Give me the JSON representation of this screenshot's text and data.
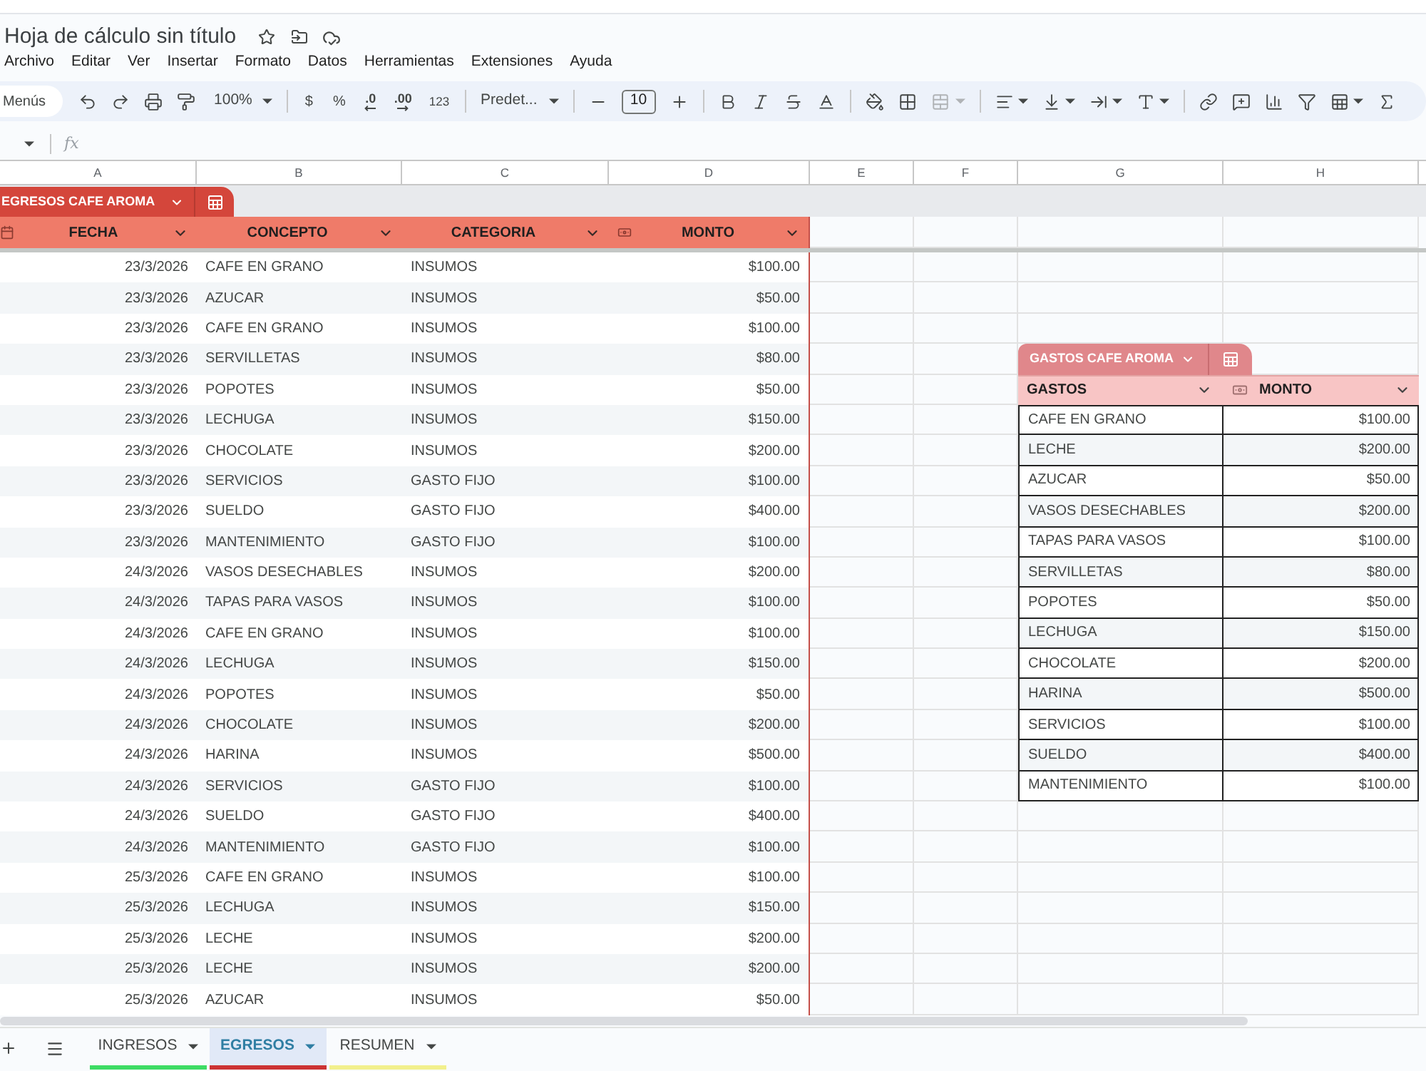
{
  "document": {
    "title": "Hoja de cálculo sin título"
  },
  "menu_bar": [
    "Archivo",
    "Editar",
    "Ver",
    "Insertar",
    "Formato",
    "Datos",
    "Herramientas",
    "Extensiones",
    "Ayuda"
  ],
  "toolbar": {
    "menu_search": "Menús",
    "zoom": "100%",
    "currency": "$",
    "percent": "%",
    "decrease_decimals": ".0",
    "increase_decimals": ".00",
    "number_format": "123",
    "font": "Predet...",
    "font_size": "10"
  },
  "formula_bar": {
    "label": "fx"
  },
  "column_headers": [
    "A",
    "B",
    "C",
    "D",
    "E",
    "F",
    "G",
    "H"
  ],
  "expenses_table": {
    "name": "EGRESOS CAFE AROMA",
    "columns": [
      "FECHA",
      "CONCEPTO",
      "CATEGORIA",
      "MONTO"
    ],
    "rows": [
      [
        "23/3/2026",
        "CAFE EN GRANO",
        "INSUMOS",
        "$100.00"
      ],
      [
        "23/3/2026",
        "AZUCAR",
        "INSUMOS",
        "$50.00"
      ],
      [
        "23/3/2026",
        "CAFE EN GRANO",
        "INSUMOS",
        "$100.00"
      ],
      [
        "23/3/2026",
        "SERVILLETAS",
        "INSUMOS",
        "$80.00"
      ],
      [
        "23/3/2026",
        "POPOTES",
        "INSUMOS",
        "$50.00"
      ],
      [
        "23/3/2026",
        "LECHUGA",
        "INSUMOS",
        "$150.00"
      ],
      [
        "23/3/2026",
        "CHOCOLATE",
        "INSUMOS",
        "$200.00"
      ],
      [
        "23/3/2026",
        "SERVICIOS",
        "GASTO FIJO",
        "$100.00"
      ],
      [
        "23/3/2026",
        "SUELDO",
        "GASTO FIJO",
        "$400.00"
      ],
      [
        "23/3/2026",
        "MANTENIMIENTO",
        "GASTO FIJO",
        "$100.00"
      ],
      [
        "24/3/2026",
        "VASOS DESECHABLES",
        "INSUMOS",
        "$200.00"
      ],
      [
        "24/3/2026",
        "TAPAS PARA VASOS",
        "INSUMOS",
        "$100.00"
      ],
      [
        "24/3/2026",
        "CAFE EN GRANO",
        "INSUMOS",
        "$100.00"
      ],
      [
        "24/3/2026",
        "LECHUGA",
        "INSUMOS",
        "$150.00"
      ],
      [
        "24/3/2026",
        "POPOTES",
        "INSUMOS",
        "$50.00"
      ],
      [
        "24/3/2026",
        "CHOCOLATE",
        "INSUMOS",
        "$200.00"
      ],
      [
        "24/3/2026",
        "HARINA",
        "INSUMOS",
        "$500.00"
      ],
      [
        "24/3/2026",
        "SERVICIOS",
        "GASTO FIJO",
        "$100.00"
      ],
      [
        "24/3/2026",
        "SUELDO",
        "GASTO FIJO",
        "$400.00"
      ],
      [
        "24/3/2026",
        "MANTENIMIENTO",
        "GASTO FIJO",
        "$100.00"
      ],
      [
        "25/3/2026",
        "CAFE EN GRANO",
        "INSUMOS",
        "$100.00"
      ],
      [
        "25/3/2026",
        "LECHUGA",
        "INSUMOS",
        "$150.00"
      ],
      [
        "25/3/2026",
        "LECHE",
        "INSUMOS",
        "$200.00"
      ],
      [
        "25/3/2026",
        "LECHE",
        "INSUMOS",
        "$200.00"
      ],
      [
        "25/3/2026",
        "AZUCAR",
        "INSUMOS",
        "$50.00"
      ]
    ]
  },
  "summary_table": {
    "name": "GASTOS CAFE AROMA",
    "columns": [
      "GASTOS",
      "MONTO"
    ],
    "rows": [
      [
        "CAFE EN GRANO",
        "$100.00"
      ],
      [
        "LECHE",
        "$200.00"
      ],
      [
        "AZUCAR",
        "$50.00"
      ],
      [
        "VASOS DESECHABLES",
        "$200.00"
      ],
      [
        "TAPAS PARA VASOS",
        "$100.00"
      ],
      [
        "SERVILLETAS",
        "$80.00"
      ],
      [
        "POPOTES",
        "$50.00"
      ],
      [
        "LECHUGA",
        "$150.00"
      ],
      [
        "CHOCOLATE",
        "$200.00"
      ],
      [
        "HARINA",
        "$500.00"
      ],
      [
        "SERVICIOS",
        "$100.00"
      ],
      [
        "SUELDO",
        "$400.00"
      ],
      [
        "MANTENIMIENTO",
        "$100.00"
      ]
    ]
  },
  "sheet_tabs": [
    {
      "label": "INGRESOS",
      "color": "#3ddc64",
      "selected": false
    },
    {
      "label": "EGRESOS",
      "color": "#cc3333",
      "selected": true
    },
    {
      "label": "RESUMEN",
      "color": "#f2f08c",
      "selected": false
    }
  ]
}
